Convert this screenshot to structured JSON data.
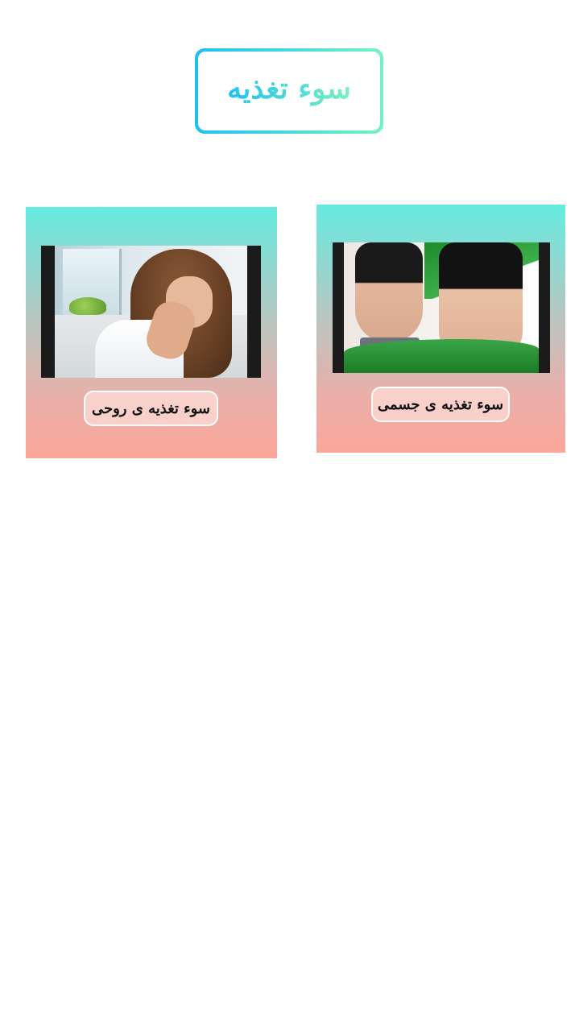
{
  "page": {
    "title": "سوء تغذیه"
  },
  "cards": [
    {
      "id": "mental",
      "label": "سوء تغذیه ی روحی",
      "image_alt": "woman-covering-face"
    },
    {
      "id": "physical",
      "label": "سوء تغذیه ی جسمی",
      "image_alt": "thin-torso-measuring"
    }
  ],
  "colors": {
    "title_gradient_start": "#1ec0f0",
    "title_gradient_end": "#74f2c4",
    "card_gradient_top": "#65ebe0",
    "card_gradient_bottom": "#fca69a"
  }
}
